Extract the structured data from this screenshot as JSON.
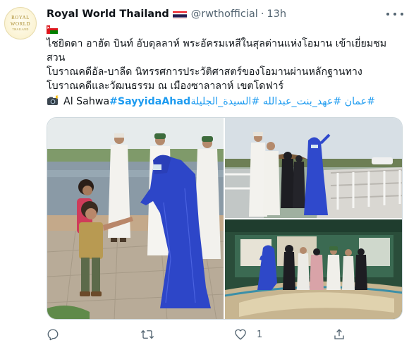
{
  "tweet": {
    "avatar_lines": [
      "ROYAL",
      "WORLD",
      "THAILAND"
    ],
    "display_name": "Royal World Thailand",
    "handle": "@rwthofficial",
    "separator": "·",
    "time": "13h",
    "body_lines": [
      "ไชยิดดา อาฮัด บินท์ อับดุลลาห์ พระอัครมเหสีในสุลต่านแห่งโอมาน เข้าเยี่ยมชมสวน",
      "โบราณคดีอัล-บาลีด นิทรรศการประวัติศาสตร์ของโอมานผ่านหลักฐานทาง",
      "โบราณคดีและวัฒนธรรม ณ เมืองซาลาลาห์ เขตโดฟาร์"
    ],
    "source": "Al Sahwa",
    "hashtag_en": "#SayyidaAhad",
    "hashtags_ar": "#عمان #عهد_بنت_عبدالله #السيدة_الجليلة",
    "icons": {
      "flag_thailand": "thailand-flag-icon",
      "flag_oman": "oman-flag-icon",
      "camera": "camera-with-flash-icon",
      "more": "more-horizontal-icon",
      "reply": "reply-icon",
      "retweet": "retweet-icon",
      "like": "heart-icon",
      "share": "share-icon"
    }
  },
  "actions": {
    "like_count": "1"
  },
  "colors": {
    "link": "#1d9bf0",
    "secondary_text": "#536471",
    "primary_text": "#0f1419",
    "border": "#cfd9de"
  }
}
